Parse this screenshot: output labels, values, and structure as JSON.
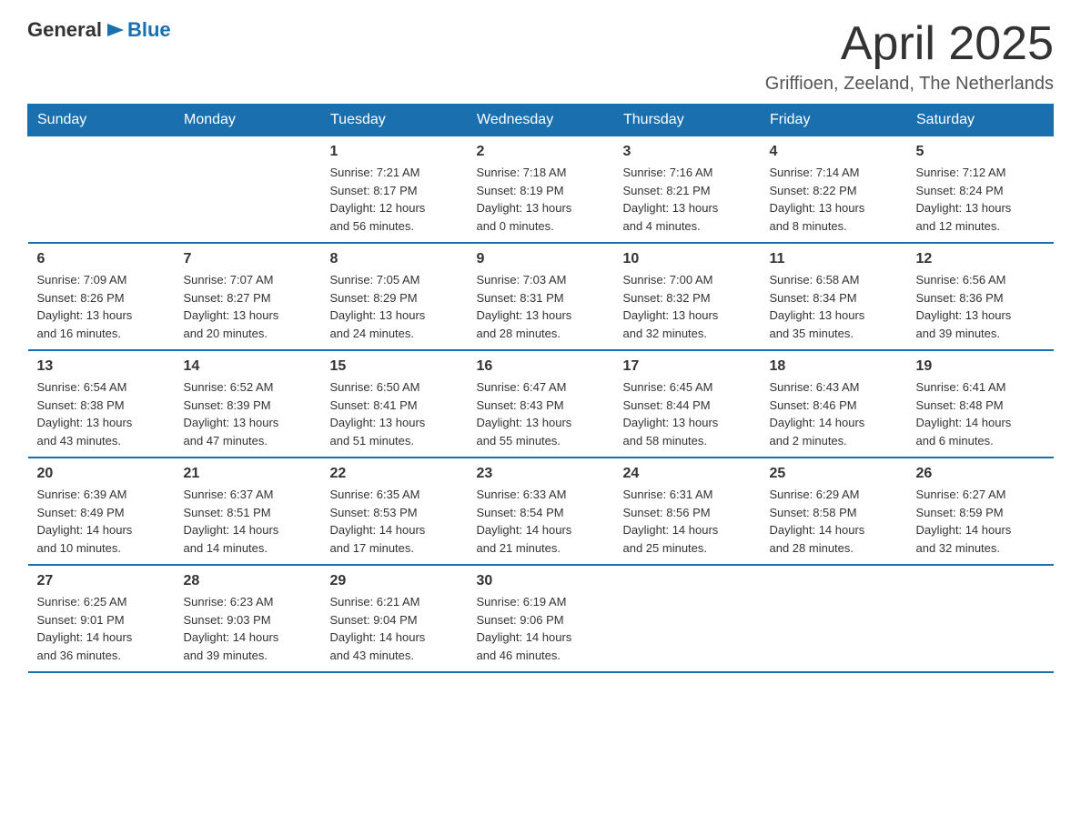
{
  "header": {
    "logo": {
      "general": "General",
      "arrow": "▶",
      "blue": "Blue"
    },
    "title": "April 2025",
    "location": "Griffioen, Zeeland, The Netherlands"
  },
  "days_of_week": [
    "Sunday",
    "Monday",
    "Tuesday",
    "Wednesday",
    "Thursday",
    "Friday",
    "Saturday"
  ],
  "weeks": [
    [
      {
        "day": "",
        "info": ""
      },
      {
        "day": "",
        "info": ""
      },
      {
        "day": "1",
        "info": "Sunrise: 7:21 AM\nSunset: 8:17 PM\nDaylight: 12 hours\nand 56 minutes."
      },
      {
        "day": "2",
        "info": "Sunrise: 7:18 AM\nSunset: 8:19 PM\nDaylight: 13 hours\nand 0 minutes."
      },
      {
        "day": "3",
        "info": "Sunrise: 7:16 AM\nSunset: 8:21 PM\nDaylight: 13 hours\nand 4 minutes."
      },
      {
        "day": "4",
        "info": "Sunrise: 7:14 AM\nSunset: 8:22 PM\nDaylight: 13 hours\nand 8 minutes."
      },
      {
        "day": "5",
        "info": "Sunrise: 7:12 AM\nSunset: 8:24 PM\nDaylight: 13 hours\nand 12 minutes."
      }
    ],
    [
      {
        "day": "6",
        "info": "Sunrise: 7:09 AM\nSunset: 8:26 PM\nDaylight: 13 hours\nand 16 minutes."
      },
      {
        "day": "7",
        "info": "Sunrise: 7:07 AM\nSunset: 8:27 PM\nDaylight: 13 hours\nand 20 minutes."
      },
      {
        "day": "8",
        "info": "Sunrise: 7:05 AM\nSunset: 8:29 PM\nDaylight: 13 hours\nand 24 minutes."
      },
      {
        "day": "9",
        "info": "Sunrise: 7:03 AM\nSunset: 8:31 PM\nDaylight: 13 hours\nand 28 minutes."
      },
      {
        "day": "10",
        "info": "Sunrise: 7:00 AM\nSunset: 8:32 PM\nDaylight: 13 hours\nand 32 minutes."
      },
      {
        "day": "11",
        "info": "Sunrise: 6:58 AM\nSunset: 8:34 PM\nDaylight: 13 hours\nand 35 minutes."
      },
      {
        "day": "12",
        "info": "Sunrise: 6:56 AM\nSunset: 8:36 PM\nDaylight: 13 hours\nand 39 minutes."
      }
    ],
    [
      {
        "day": "13",
        "info": "Sunrise: 6:54 AM\nSunset: 8:38 PM\nDaylight: 13 hours\nand 43 minutes."
      },
      {
        "day": "14",
        "info": "Sunrise: 6:52 AM\nSunset: 8:39 PM\nDaylight: 13 hours\nand 47 minutes."
      },
      {
        "day": "15",
        "info": "Sunrise: 6:50 AM\nSunset: 8:41 PM\nDaylight: 13 hours\nand 51 minutes."
      },
      {
        "day": "16",
        "info": "Sunrise: 6:47 AM\nSunset: 8:43 PM\nDaylight: 13 hours\nand 55 minutes."
      },
      {
        "day": "17",
        "info": "Sunrise: 6:45 AM\nSunset: 8:44 PM\nDaylight: 13 hours\nand 58 minutes."
      },
      {
        "day": "18",
        "info": "Sunrise: 6:43 AM\nSunset: 8:46 PM\nDaylight: 14 hours\nand 2 minutes."
      },
      {
        "day": "19",
        "info": "Sunrise: 6:41 AM\nSunset: 8:48 PM\nDaylight: 14 hours\nand 6 minutes."
      }
    ],
    [
      {
        "day": "20",
        "info": "Sunrise: 6:39 AM\nSunset: 8:49 PM\nDaylight: 14 hours\nand 10 minutes."
      },
      {
        "day": "21",
        "info": "Sunrise: 6:37 AM\nSunset: 8:51 PM\nDaylight: 14 hours\nand 14 minutes."
      },
      {
        "day": "22",
        "info": "Sunrise: 6:35 AM\nSunset: 8:53 PM\nDaylight: 14 hours\nand 17 minutes."
      },
      {
        "day": "23",
        "info": "Sunrise: 6:33 AM\nSunset: 8:54 PM\nDaylight: 14 hours\nand 21 minutes."
      },
      {
        "day": "24",
        "info": "Sunrise: 6:31 AM\nSunset: 8:56 PM\nDaylight: 14 hours\nand 25 minutes."
      },
      {
        "day": "25",
        "info": "Sunrise: 6:29 AM\nSunset: 8:58 PM\nDaylight: 14 hours\nand 28 minutes."
      },
      {
        "day": "26",
        "info": "Sunrise: 6:27 AM\nSunset: 8:59 PM\nDaylight: 14 hours\nand 32 minutes."
      }
    ],
    [
      {
        "day": "27",
        "info": "Sunrise: 6:25 AM\nSunset: 9:01 PM\nDaylight: 14 hours\nand 36 minutes."
      },
      {
        "day": "28",
        "info": "Sunrise: 6:23 AM\nSunset: 9:03 PM\nDaylight: 14 hours\nand 39 minutes."
      },
      {
        "day": "29",
        "info": "Sunrise: 6:21 AM\nSunset: 9:04 PM\nDaylight: 14 hours\nand 43 minutes."
      },
      {
        "day": "30",
        "info": "Sunrise: 6:19 AM\nSunset: 9:06 PM\nDaylight: 14 hours\nand 46 minutes."
      },
      {
        "day": "",
        "info": ""
      },
      {
        "day": "",
        "info": ""
      },
      {
        "day": "",
        "info": ""
      }
    ]
  ]
}
